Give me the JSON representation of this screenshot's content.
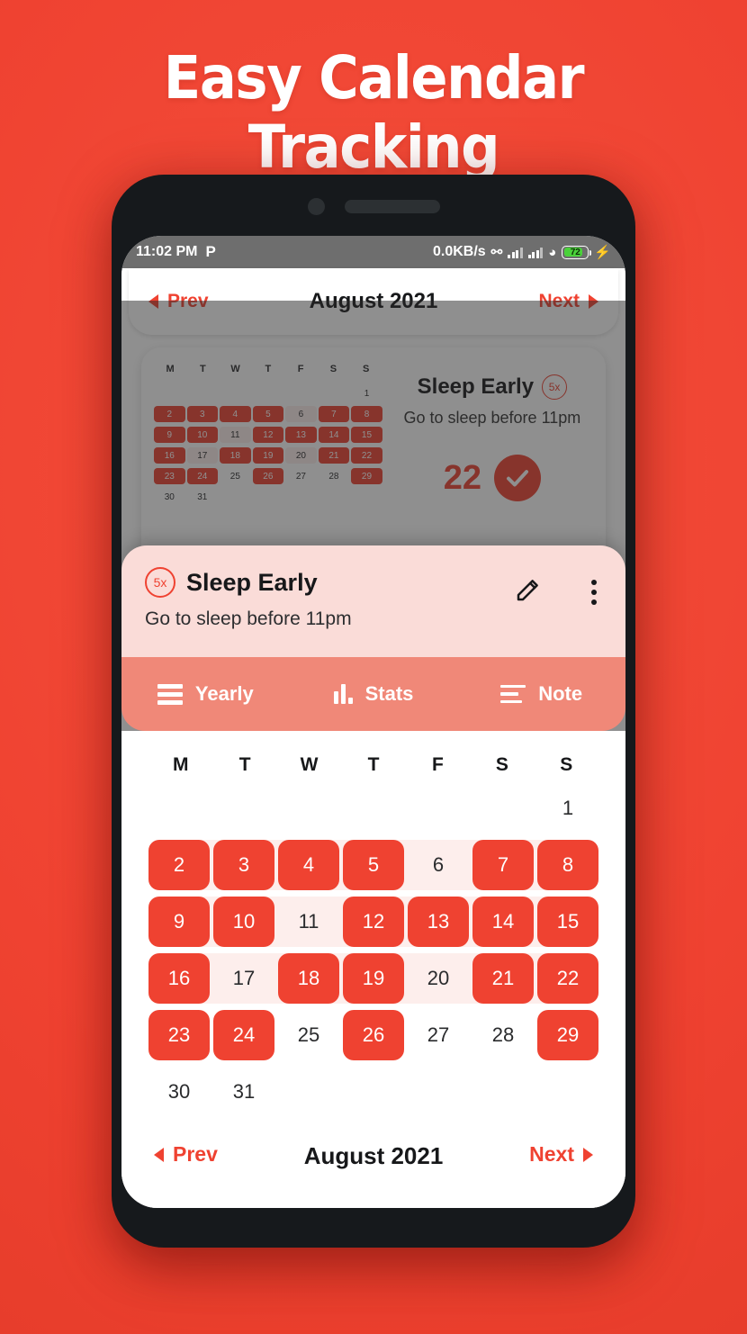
{
  "headline": "Easy Calendar Tracking",
  "colors": {
    "brand_red": "#ef4231",
    "page_bg": "#f4503c",
    "sheet_header_pink": "#fadcd8",
    "tabbar_salmon": "#f08878",
    "cell_pale": "#fdeeec",
    "statusbar_gray": "#6e6e6e",
    "battery_green": "#4ad23a"
  },
  "statusbar": {
    "time": "11:02 PM",
    "app_icon": "P",
    "network_speed": "0.0KB/s",
    "bluetooth_icon": "bluetooth-icon",
    "signal1_icon": "signal-bars-icon",
    "signal2_icon": "signal-bars-icon",
    "wifi_icon": "wifi-icon",
    "battery_level": "72",
    "charging_icon": "lightning-bolt-icon"
  },
  "background_app": {
    "nav": {
      "prev_label": "Prev",
      "title": "August 2021",
      "next_label": "Next",
      "prev_icon": "triangle-left-icon",
      "next_icon": "triangle-right-icon"
    },
    "card": {
      "dow": [
        "M",
        "T",
        "W",
        "T",
        "F",
        "S",
        "S"
      ],
      "habit_title": "Sleep Early",
      "habit_badge": "5x",
      "habit_subtitle": "Go to sleep before 11pm",
      "count": "22",
      "check_icon": "check-circle-icon"
    }
  },
  "sheet": {
    "badge": "5x",
    "title": "Sleep Early",
    "subtitle": "Go to sleep before 11pm",
    "edit_icon": "pencil-icon",
    "menu_icon": "more-vertical-icon",
    "tabs": [
      {
        "label": "Yearly",
        "icon": "stacked-lines-icon"
      },
      {
        "label": "Stats",
        "icon": "bar-chart-icon"
      },
      {
        "label": "Note",
        "icon": "align-left-icon"
      }
    ],
    "calendar": {
      "dow": [
        "M",
        "T",
        "W",
        "T",
        "F",
        "S",
        "S"
      ],
      "nav": {
        "prev_label": "Prev",
        "title": "August 2021",
        "next_label": "Next",
        "prev_icon": "triangle-left-icon",
        "next_icon": "triangle-right-icon"
      },
      "weeks": [
        {
          "banded": false,
          "cells": [
            {
              "label": "",
              "state": "empty"
            },
            {
              "label": "",
              "state": "empty"
            },
            {
              "label": "",
              "state": "empty"
            },
            {
              "label": "",
              "state": "empty"
            },
            {
              "label": "",
              "state": "empty"
            },
            {
              "label": "",
              "state": "empty"
            },
            {
              "label": "1",
              "state": "off"
            }
          ]
        },
        {
          "banded": true,
          "cells": [
            {
              "label": "2",
              "state": "on"
            },
            {
              "label": "3",
              "state": "on"
            },
            {
              "label": "4",
              "state": "on"
            },
            {
              "label": "5",
              "state": "on"
            },
            {
              "label": "6",
              "state": "off"
            },
            {
              "label": "7",
              "state": "on"
            },
            {
              "label": "8",
              "state": "on"
            }
          ]
        },
        {
          "banded": true,
          "cells": [
            {
              "label": "9",
              "state": "on"
            },
            {
              "label": "10",
              "state": "on"
            },
            {
              "label": "11",
              "state": "off"
            },
            {
              "label": "12",
              "state": "on"
            },
            {
              "label": "13",
              "state": "on"
            },
            {
              "label": "14",
              "state": "on"
            },
            {
              "label": "15",
              "state": "on"
            }
          ]
        },
        {
          "banded": true,
          "cells": [
            {
              "label": "16",
              "state": "on"
            },
            {
              "label": "17",
              "state": "off"
            },
            {
              "label": "18",
              "state": "on"
            },
            {
              "label": "19",
              "state": "on"
            },
            {
              "label": "20",
              "state": "off"
            },
            {
              "label": "21",
              "state": "on"
            },
            {
              "label": "22",
              "state": "on"
            }
          ]
        },
        {
          "banded": false,
          "cells": [
            {
              "label": "23",
              "state": "on"
            },
            {
              "label": "24",
              "state": "on"
            },
            {
              "label": "25",
              "state": "off"
            },
            {
              "label": "26",
              "state": "on"
            },
            {
              "label": "27",
              "state": "off"
            },
            {
              "label": "28",
              "state": "off"
            },
            {
              "label": "29",
              "state": "on"
            }
          ]
        },
        {
          "banded": false,
          "cells": [
            {
              "label": "30",
              "state": "off"
            },
            {
              "label": "31",
              "state": "off"
            },
            {
              "label": "",
              "state": "empty"
            },
            {
              "label": "",
              "state": "empty"
            },
            {
              "label": "",
              "state": "empty"
            },
            {
              "label": "",
              "state": "empty"
            },
            {
              "label": "",
              "state": "empty"
            }
          ]
        }
      ]
    }
  }
}
